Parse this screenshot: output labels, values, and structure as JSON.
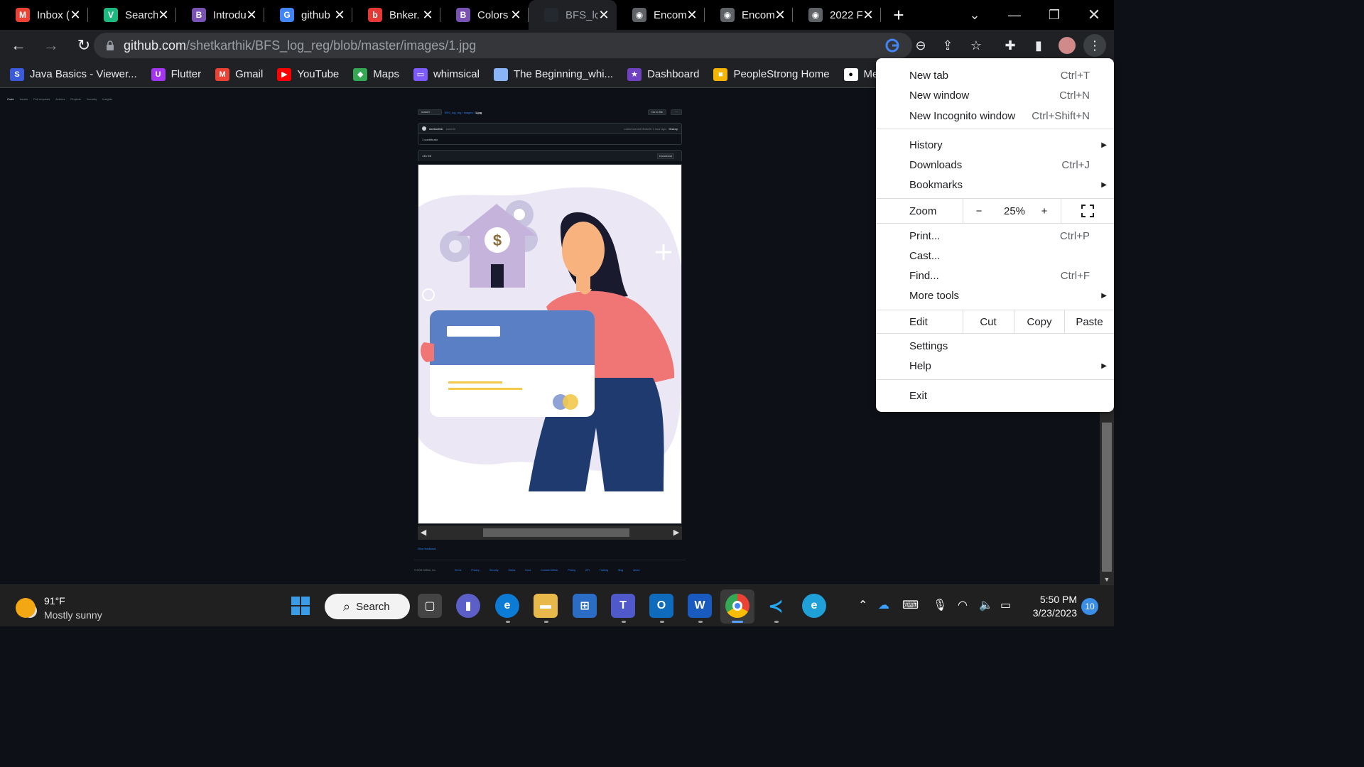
{
  "tabs": [
    {
      "title": "Inbox (",
      "icon": "gmail-icon",
      "color": "#ea4335",
      "glyph": "M"
    },
    {
      "title": "Search",
      "icon": "vuetify-icon",
      "color": "#1eb980",
      "glyph": "V"
    },
    {
      "title": "Introdu",
      "icon": "bootstrap-icon",
      "color": "#7952b3",
      "glyph": "B"
    },
    {
      "title": "github",
      "icon": "google-icon",
      "color": "#4285f4",
      "glyph": "G"
    },
    {
      "title": "Bnker.",
      "icon": "bnker-icon",
      "color": "#e53935",
      "glyph": "b"
    },
    {
      "title": "Colors",
      "icon": "bootstrap-icon",
      "color": "#7952b3",
      "glyph": "B"
    },
    {
      "title": "BFS_lo",
      "icon": "github-icon",
      "color": "#24292f",
      "glyph": "",
      "active": true
    },
    {
      "title": "Encom",
      "icon": "globe-icon",
      "color": "#5f6368",
      "glyph": "◉"
    },
    {
      "title": "Encom",
      "icon": "globe-icon",
      "color": "#5f6368",
      "glyph": "◉"
    },
    {
      "title": "2022 F",
      "icon": "globe-icon",
      "color": "#5f6368",
      "glyph": "◉"
    }
  ],
  "omnibox": {
    "host": "github.com",
    "path": "/shetkarthik/BFS_log_reg/blob/master/images/1.jpg"
  },
  "bookmarks": [
    {
      "label": "Java Basics - Viewer...",
      "icon": "java-icon",
      "color": "#3b5bdb",
      "glyph": "S"
    },
    {
      "label": "Flutter",
      "icon": "udemy-icon",
      "color": "#a435f0",
      "glyph": "U"
    },
    {
      "label": "Gmail",
      "icon": "gmail-icon",
      "color": "#ea4335",
      "glyph": "M"
    },
    {
      "label": "YouTube",
      "icon": "youtube-icon",
      "color": "#ff0000",
      "glyph": "▶"
    },
    {
      "label": "Maps",
      "icon": "maps-icon",
      "color": "#34a853",
      "glyph": "◆"
    },
    {
      "label": "whimsical",
      "icon": "whimsical-icon",
      "color": "#7c5cff",
      "glyph": "▭"
    },
    {
      "label": "The Beginning_whi...",
      "icon": "folder-icon",
      "color": "#8ab4f8",
      "glyph": ""
    },
    {
      "label": "Dashboard",
      "icon": "dashboard-icon",
      "color": "#6f42c1",
      "glyph": "★"
    },
    {
      "label": "PeopleStrong Home",
      "icon": "peoplestrong-icon",
      "color": "#f4b400",
      "glyph": "■"
    },
    {
      "label": "Medi",
      "icon": "medium-icon",
      "color": "#ffffff",
      "glyph": "●"
    }
  ],
  "github": {
    "nav": [
      "Code",
      "Issues",
      "Pull requests",
      "Actions",
      "Projects",
      "Security",
      "Insights"
    ],
    "branch": "master",
    "breadcrumb_repo": "BFS_log_reg",
    "breadcrumb_dir": "images",
    "breadcrumb_file": "1.jpg",
    "goto_label": "Go to file",
    "more_label": "···",
    "commit_author": "shetkarthik",
    "commit_msg": "commit",
    "commit_meta": "Latest commit 9b6c0b 1 hour ago",
    "history_label": "History",
    "contributors": "1 contributor",
    "file_size": "146 KB",
    "download_label": "Download",
    "feedback_label": "Give feedback",
    "footer_links": [
      "© 2023 GitHub, Inc.",
      "Terms",
      "Privacy",
      "Security",
      "Status",
      "Docs",
      "Contact GitHub",
      "Pricing",
      "API",
      "Training",
      "Blog",
      "About"
    ]
  },
  "illustration": {
    "currency_symbol": "$",
    "colors": {
      "blob": "#ebe7f5",
      "gear": "#c9c4e0",
      "house": "#c6b3dc",
      "hair": "#1a1a2e",
      "skin": "#f7b27e",
      "sweater": "#f07575",
      "jeans": "#1e3a6e",
      "card_top": "#5b7fc4",
      "card_bottom": "#ffffff",
      "stripe": "#f2c94c"
    }
  },
  "menu": {
    "new_tab": {
      "label": "New tab",
      "shortcut": "Ctrl+T"
    },
    "new_window": {
      "label": "New window",
      "shortcut": "Ctrl+N"
    },
    "new_incognito": {
      "label": "New Incognito window",
      "shortcut": "Ctrl+Shift+N"
    },
    "history": {
      "label": "History"
    },
    "downloads": {
      "label": "Downloads",
      "shortcut": "Ctrl+J"
    },
    "bookmarks": {
      "label": "Bookmarks"
    },
    "zoom": {
      "label": "Zoom",
      "minus": "−",
      "value": "25%",
      "plus": "+"
    },
    "print": {
      "label": "Print...",
      "shortcut": "Ctrl+P"
    },
    "cast": {
      "label": "Cast..."
    },
    "find": {
      "label": "Find...",
      "shortcut": "Ctrl+F"
    },
    "more_tools": {
      "label": "More tools"
    },
    "edit": {
      "label": "Edit",
      "cut": "Cut",
      "copy": "Copy",
      "paste": "Paste"
    },
    "settings": {
      "label": "Settings"
    },
    "help": {
      "label": "Help"
    },
    "exit": {
      "label": "Exit"
    }
  },
  "taskbar": {
    "temperature": "91°F",
    "condition": "Mostly sunny",
    "search_label": "Search",
    "time": "5:50 PM",
    "date": "3/23/2023",
    "notifications": "10"
  }
}
